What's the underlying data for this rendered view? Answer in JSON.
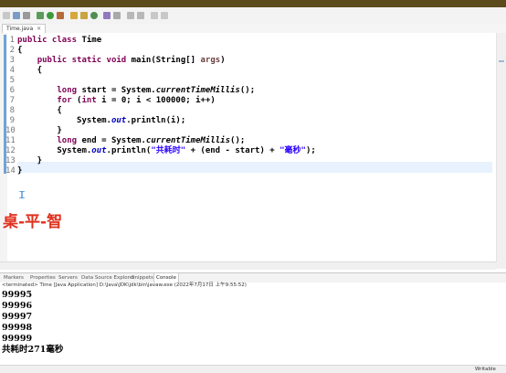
{
  "toolbar": {
    "icons": [
      "new-icon",
      "save-icon",
      "print-icon",
      "debug-icon",
      "run-icon",
      "external-tools-icon",
      "new-java-project-icon",
      "new-package-icon",
      "new-class-icon",
      "open-type-icon",
      "search-icon",
      "next-annotation-icon",
      "prev-annotation-icon",
      "back-icon",
      "forward-icon"
    ]
  },
  "editor": {
    "tab_label": "Time.java",
    "tab_close": "✕",
    "line_numbers": [
      "1",
      "2",
      "3",
      "4",
      "5",
      "6",
      "7",
      "8",
      "9",
      "10",
      "11",
      "12",
      "13",
      "14"
    ],
    "lines": [
      [
        {
          "t": "kw",
          "v": "public class "
        },
        {
          "t": "plain",
          "v": "Time"
        }
      ],
      [
        {
          "t": "plain",
          "v": "{"
        }
      ],
      [
        {
          "t": "plain",
          "v": "    "
        },
        {
          "t": "kw",
          "v": "public static void "
        },
        {
          "t": "plain",
          "v": "main(String[] "
        },
        {
          "t": "par",
          "v": "args"
        },
        {
          "t": "plain",
          "v": ")"
        }
      ],
      [
        {
          "t": "plain",
          "v": "    {"
        }
      ],
      [
        {
          "t": "plain",
          "v": ""
        }
      ],
      [
        {
          "t": "plain",
          "v": "        "
        },
        {
          "t": "kw",
          "v": "long "
        },
        {
          "t": "plain",
          "v": "start = System."
        },
        {
          "t": "it",
          "v": "currentTimeMillis"
        },
        {
          "t": "plain",
          "v": "();"
        }
      ],
      [
        {
          "t": "plain",
          "v": "        "
        },
        {
          "t": "kw",
          "v": "for "
        },
        {
          "t": "plain",
          "v": "("
        },
        {
          "t": "kw",
          "v": "int "
        },
        {
          "t": "plain",
          "v": "i = 0; i < 100000; i++)"
        }
      ],
      [
        {
          "t": "plain",
          "v": "        {"
        }
      ],
      [
        {
          "t": "plain",
          "v": "            System."
        },
        {
          "t": "field",
          "v": "out"
        },
        {
          "t": "plain",
          "v": ".println(i);"
        }
      ],
      [
        {
          "t": "plain",
          "v": "        }"
        }
      ],
      [
        {
          "t": "plain",
          "v": "        "
        },
        {
          "t": "kw",
          "v": "long "
        },
        {
          "t": "plain",
          "v": "end = System."
        },
        {
          "t": "it",
          "v": "currentTimeMillis"
        },
        {
          "t": "plain",
          "v": "();"
        }
      ],
      [
        {
          "t": "plain",
          "v": "        System."
        },
        {
          "t": "field",
          "v": "out"
        },
        {
          "t": "plain",
          "v": ".println("
        },
        {
          "t": "str",
          "v": "\"共耗时\""
        },
        {
          "t": "plain",
          "v": " + (end - start) + "
        },
        {
          "t": "str",
          "v": "\"毫秒\""
        },
        {
          "t": "plain",
          "v": ");"
        }
      ],
      [
        {
          "t": "plain",
          "v": "    }"
        }
      ],
      [
        {
          "t": "plain",
          "v": "}"
        }
      ]
    ],
    "watermark": "桌-平-智"
  },
  "views": {
    "tabs": [
      "Markers",
      "Properties",
      "Servers",
      "Data Source Explorer",
      "Snippets",
      "Console"
    ],
    "active": "Console"
  },
  "console": {
    "header": "<terminated> Time [Java Application] D:\\Java\\JDK\\jdk\\bin\\javaw.exe (2022年7月17日 上午9:55:52)",
    "output": [
      "99995",
      "99996",
      "99997",
      "99998",
      "99999",
      "共耗时271毫秒"
    ]
  },
  "status": {
    "writable": "Writable"
  },
  "colors": {
    "keyword": "#7f0055",
    "string": "#2a00ff",
    "field": "#0000c0",
    "watermark": "#e0301e",
    "titlebar": "#5b4a1c"
  }
}
